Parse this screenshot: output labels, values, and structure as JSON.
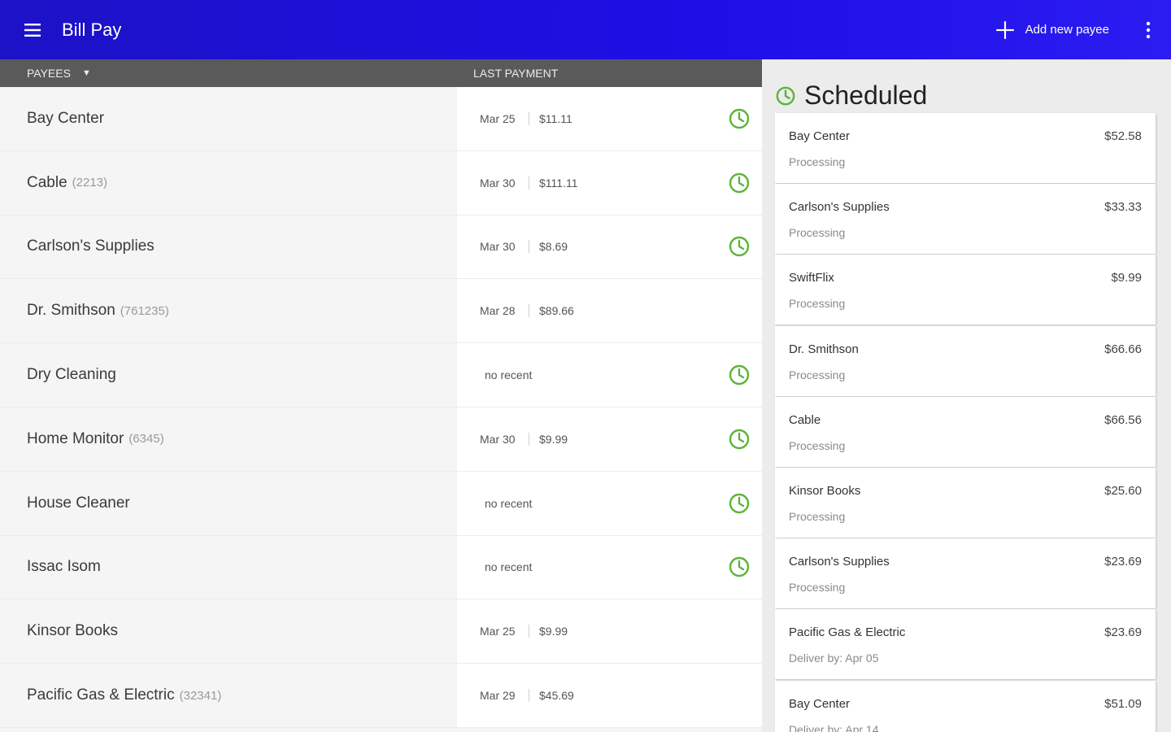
{
  "appbar": {
    "title": "Bill Pay",
    "add_payee_label": "Add new payee",
    "icons": {
      "menu": "hamburger-menu-icon",
      "add": "plus-icon",
      "overflow": "more-vertical-icon"
    }
  },
  "list_header": {
    "payees_label": "PAYEES",
    "last_payment_label": "LAST PAYMENT"
  },
  "payees": [
    {
      "name": "Bay Center",
      "account": "",
      "date": "Mar 25",
      "amount": "$11.11",
      "recent": true,
      "scheduled": true
    },
    {
      "name": "Cable",
      "account": "(2213)",
      "date": "Mar 30",
      "amount": "$111.11",
      "recent": true,
      "scheduled": true
    },
    {
      "name": "Carlson's Supplies",
      "account": "",
      "date": "Mar 30",
      "amount": "$8.69",
      "recent": true,
      "scheduled": true
    },
    {
      "name": "Dr. Smithson",
      "account": "(761235)",
      "date": "Mar 28",
      "amount": "$89.66",
      "recent": true,
      "scheduled": false
    },
    {
      "name": "Dry Cleaning",
      "account": "",
      "no_recent": "no recent",
      "recent": false,
      "scheduled": true
    },
    {
      "name": "Home Monitor",
      "account": "(6345)",
      "date": "Mar 30",
      "amount": "$9.99",
      "recent": true,
      "scheduled": true
    },
    {
      "name": "House Cleaner",
      "account": "",
      "no_recent": "no recent",
      "recent": false,
      "scheduled": true
    },
    {
      "name": "Issac Isom",
      "account": "",
      "no_recent": "no recent",
      "recent": false,
      "scheduled": true
    },
    {
      "name": "Kinsor Books",
      "account": "",
      "date": "Mar 25",
      "amount": "$9.99",
      "recent": true,
      "scheduled": false
    },
    {
      "name": "Pacific Gas & Electric",
      "account": "(32341)",
      "date": "Mar 29",
      "amount": "$45.69",
      "recent": true,
      "scheduled": false
    }
  ],
  "scheduled": {
    "title": "Scheduled",
    "items": [
      {
        "name": "Bay Center",
        "amount": "$52.58",
        "status": "Processing"
      },
      {
        "name": "Carlson's Supplies",
        "amount": "$33.33",
        "status": "Processing"
      },
      {
        "name": "SwiftFlix",
        "amount": "$9.99",
        "status": "Processing"
      },
      {
        "name": "Dr. Smithson",
        "amount": "$66.66",
        "status": "Processing"
      },
      {
        "name": "Cable",
        "amount": "$66.56",
        "status": "Processing"
      },
      {
        "name": "Kinsor Books",
        "amount": "$25.60",
        "status": "Processing"
      },
      {
        "name": "Carlson's Supplies",
        "amount": "$23.69",
        "status": "Processing"
      },
      {
        "name": "Pacific Gas & Electric",
        "amount": "$23.69",
        "status": "Deliver by: Apr 05"
      },
      {
        "name": "Bay Center",
        "amount": "$51.09",
        "status": "Deliver by: Apr 14"
      }
    ]
  },
  "colors": {
    "appbar": "#1f0ee6",
    "accent_green": "#5bb53a",
    "header_gray": "#5a5a5a"
  }
}
